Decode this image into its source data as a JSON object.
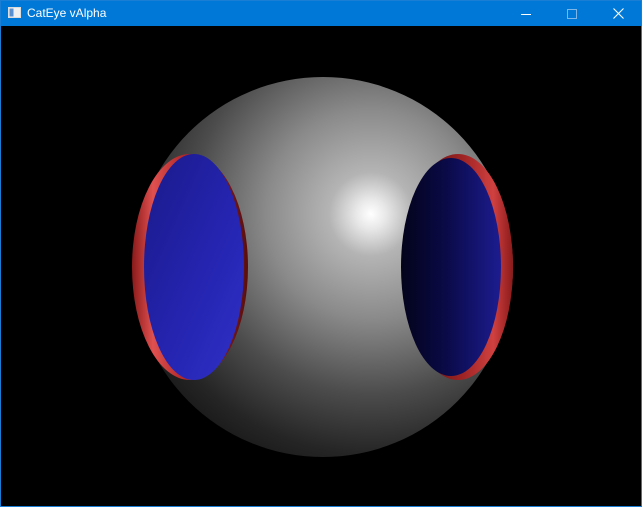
{
  "window": {
    "title": "CatEye vAlpha",
    "titlebar_color": "#0078d7",
    "controls": {
      "minimize_icon": "minimize-icon",
      "maximize_icon": "maximize-icon",
      "close_icon": "close-icon"
    }
  },
  "scene": {
    "background_color": "#000000",
    "sphere_color": "#9a9a9a",
    "rim_color": "#b42a2a",
    "socket_color": "#2323b8"
  }
}
